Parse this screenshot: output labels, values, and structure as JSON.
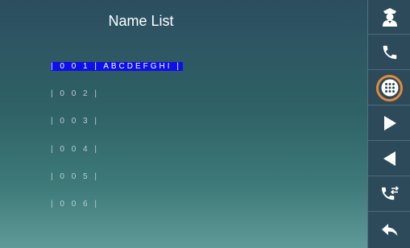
{
  "header": {
    "title": "Name List"
  },
  "entries": [
    {
      "label": "| 0 0 1 | ABCDEFGHI |",
      "selected": true
    },
    {
      "label": "| 0 0 2 |",
      "selected": false
    },
    {
      "label": "| 0 0 3 |",
      "selected": false
    },
    {
      "label": "| 0 0 4 |",
      "selected": false
    },
    {
      "label": "| 0 0 5 |",
      "selected": false
    },
    {
      "label": "| 0 0 6 |",
      "selected": false
    }
  ],
  "sidebar": {
    "buttons": [
      {
        "icon": "guard-icon"
      },
      {
        "icon": "phone-icon"
      },
      {
        "icon": "keypad-icon",
        "highlighted": true
      },
      {
        "icon": "play-right-icon"
      },
      {
        "icon": "play-left-icon"
      },
      {
        "icon": "call-transfer-icon"
      },
      {
        "icon": "back-arrow-icon"
      }
    ]
  },
  "colors": {
    "selection": "#0d10e8",
    "highlight_ring": "#e58a3a",
    "sidebar_bg": "#2c4a5a"
  }
}
